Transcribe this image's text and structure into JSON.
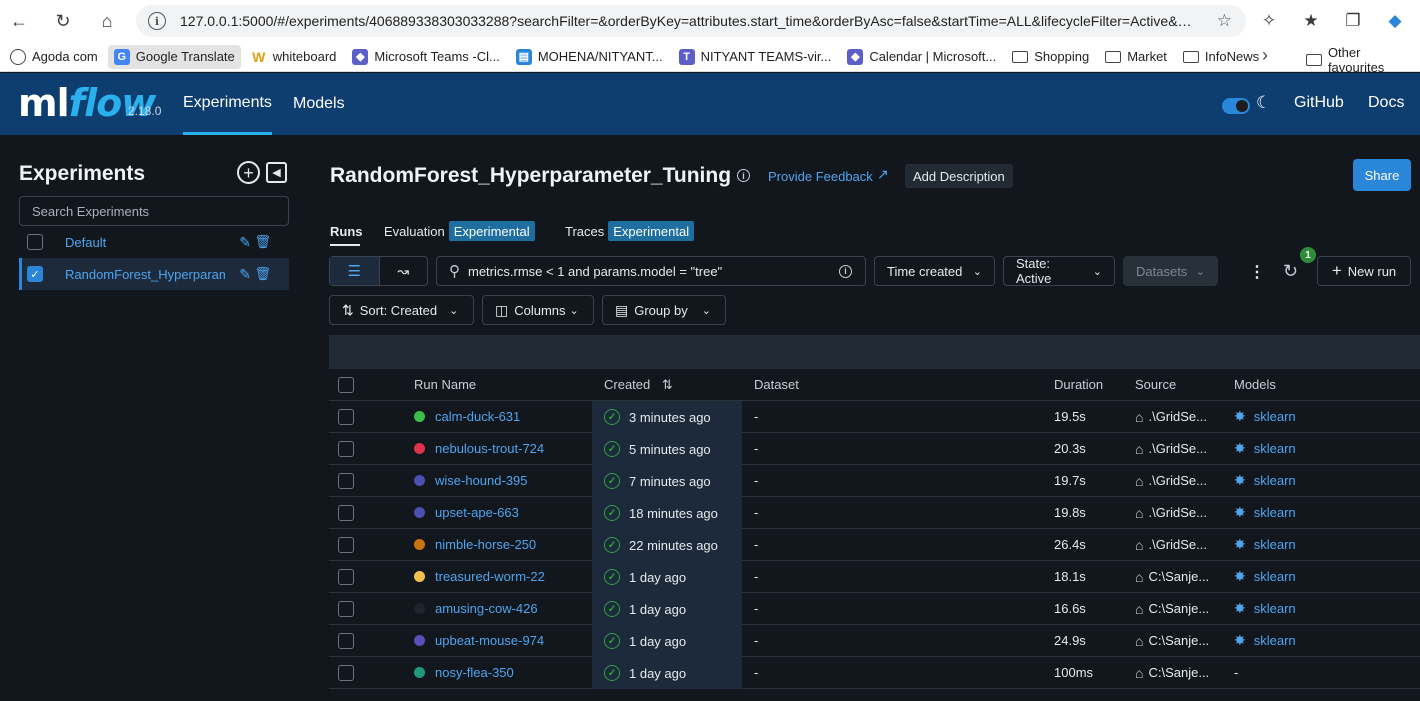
{
  "browser": {
    "url": "127.0.0.1:5000/#/experiments/406889338303033288?searchFilter=&orderByKey=attributes.start_time&orderByAsc=false&startTime=ALL&lifecycleFilter=Active&…",
    "bookmarks": [
      {
        "label": "Agoda com",
        "icon": "globe-icon"
      },
      {
        "label": "Google Translate",
        "icon": "translate-icon"
      },
      {
        "label": "whiteboard",
        "icon": "w-icon"
      },
      {
        "label": "Microsoft Teams -Cl...",
        "icon": "teams-icon"
      },
      {
        "label": "MOHENA/NITYANT...",
        "icon": "doc-icon"
      },
      {
        "label": "NITYANT TEAMS-vir...",
        "icon": "teams-icon"
      },
      {
        "label": "Calendar | Microsoft...",
        "icon": "teams-icon"
      },
      {
        "label": "Shopping",
        "icon": "folder-icon"
      },
      {
        "label": "Market",
        "icon": "folder-icon"
      },
      {
        "label": "InfoNews",
        "icon": "folder-icon"
      }
    ],
    "other_favourites": "Other favourites"
  },
  "header": {
    "logo_ml": "ml",
    "logo_flow": "flow",
    "version": "2.18.0",
    "nav_experiments": "Experiments",
    "nav_models": "Models",
    "github": "GitHub",
    "docs": "Docs"
  },
  "sidebar": {
    "title": "Experiments",
    "search_placeholder": "Search Experiments",
    "items": [
      {
        "name": "Default",
        "checked": false
      },
      {
        "name": "RandomForest_Hyperparameter_Tuning",
        "checked": true
      }
    ]
  },
  "main": {
    "title": "RandomForest_Hyperparameter_Tuning",
    "feedback": "Provide Feedback",
    "add_description": "Add Description",
    "share": "Share",
    "tabs": {
      "runs": "Runs",
      "evaluation": "Evaluation",
      "traces": "Traces",
      "experimental": "Experimental"
    },
    "search_query": "metrics.rmse < 1 and params.model = \"tree\"",
    "time_created": "Time created",
    "state": "State: Active",
    "datasets": "Datasets",
    "refresh_badge": "1",
    "new_run": "New run",
    "sort": "Sort: Created",
    "columns": "Columns",
    "group_by": "Group by"
  },
  "table": {
    "headers": {
      "run_name": "Run Name",
      "created": "Created",
      "dataset": "Dataset",
      "duration": "Duration",
      "source": "Source",
      "models": "Models"
    },
    "rows": [
      {
        "name": "calm-duck-631",
        "color": "#3bbf4a",
        "created": "3 minutes ago",
        "dataset": "-",
        "duration": "19.5s",
        "source": ".\\GridSe...",
        "model": "sklearn"
      },
      {
        "name": "nebulous-trout-724",
        "color": "#e0344a",
        "created": "5 minutes ago",
        "dataset": "-",
        "duration": "20.3s",
        "source": ".\\GridSe...",
        "model": "sklearn"
      },
      {
        "name": "wise-hound-395",
        "color": "#4a4fb0",
        "created": "7 minutes ago",
        "dataset": "-",
        "duration": "19.7s",
        "source": ".\\GridSe...",
        "model": "sklearn"
      },
      {
        "name": "upset-ape-663",
        "color": "#4a4fb0",
        "created": "18 minutes ago",
        "dataset": "-",
        "duration": "19.8s",
        "source": ".\\GridSe...",
        "model": "sklearn"
      },
      {
        "name": "nimble-horse-250",
        "color": "#c7740f",
        "created": "22 minutes ago",
        "dataset": "-",
        "duration": "26.4s",
        "source": ".\\GridSe...",
        "model": "sklearn"
      },
      {
        "name": "treasured-worm-22",
        "color": "#f2c14b",
        "created": "1 day ago",
        "dataset": "-",
        "duration": "18.1s",
        "source": "C:\\Sanje...",
        "model": "sklearn"
      },
      {
        "name": "amusing-cow-426",
        "color": "#1e252c",
        "created": "1 day ago",
        "dataset": "-",
        "duration": "16.6s",
        "source": "C:\\Sanje...",
        "model": "sklearn"
      },
      {
        "name": "upbeat-mouse-974",
        "color": "#5a4fb8",
        "created": "1 day ago",
        "dataset": "-",
        "duration": "24.9s",
        "source": "C:\\Sanje...",
        "model": "sklearn"
      },
      {
        "name": "nosy-flea-350",
        "color": "#1d9a7a",
        "created": "1 day ago",
        "dataset": "-",
        "duration": "100ms",
        "source": "C:\\Sanje...",
        "model": "-"
      }
    ]
  }
}
